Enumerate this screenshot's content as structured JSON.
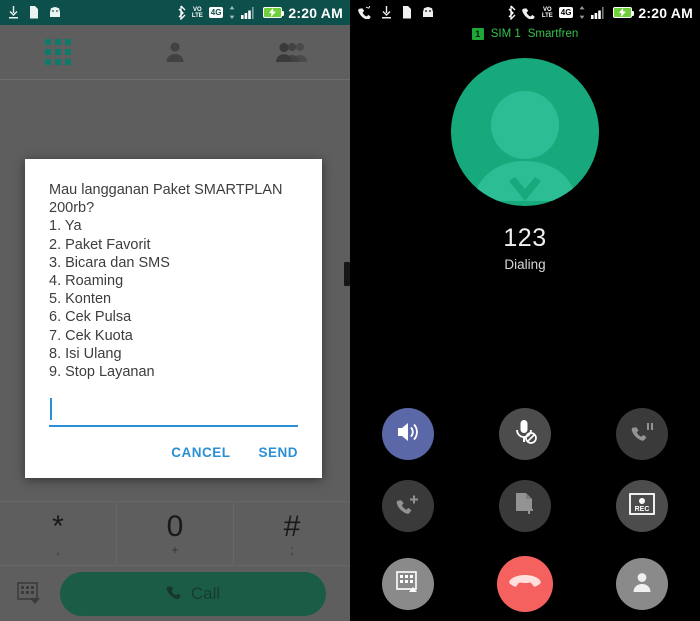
{
  "left_panel": {
    "statusbar": {
      "time": "2:20 AM",
      "icons": [
        "download-icon",
        "sd-card-icon",
        "android-icon",
        "bluetooth-icon",
        "volte-icon",
        "4g-icon",
        "signal-bars-icon",
        "battery-charging-icon"
      ],
      "volte_label": "VO",
      "volte_sub": "LTE",
      "network_label": "4G"
    },
    "tabs": [
      {
        "name": "dialpad",
        "icon": "dialpad-grid-icon",
        "active": true
      },
      {
        "name": "contacts",
        "icon": "person-icon",
        "active": false
      },
      {
        "name": "groups",
        "icon": "people-group-icon",
        "active": false
      }
    ],
    "keypad": [
      {
        "main": "*",
        "sub": ","
      },
      {
        "main": "0",
        "sub": "+"
      },
      {
        "main": "#",
        "sub": ";"
      }
    ],
    "call_bar": {
      "hide_dialpad_icon": "dialpad-collapse-icon",
      "call_label": "Call",
      "call_icon": "phone-icon",
      "call_color": "#1b5c47"
    },
    "dialog": {
      "message": "Mau langganan Paket SMARTPLAN 200rb?\n1. Ya\n2. Paket Favorit\n3. Bicara dan SMS\n4. Roaming\n5. Konten\n6. Cek Pulsa\n7. Cek Kuota\n8. Isi Ulang\n9. Stop Layanan",
      "input_value": "",
      "input_placeholder": "",
      "cancel_label": "CANCEL",
      "send_label": "SEND",
      "action_color": "#2a90d3"
    }
  },
  "right_panel": {
    "statusbar": {
      "time": "2:20 AM",
      "icons": [
        "missed-call-icon",
        "download-icon",
        "sd-card-icon",
        "android-icon",
        "bluetooth-icon",
        "call-icon",
        "volte-icon",
        "4g-icon",
        "signal-bars-icon",
        "battery-charging-icon"
      ],
      "volte_label": "VO",
      "volte_sub": "LTE",
      "network_label": "4G"
    },
    "sim_line": {
      "badge": "1",
      "sim_label": "SIM 1",
      "carrier": "Smartfren",
      "color": "#37c14e"
    },
    "call": {
      "avatar_icon": "person-avatar-icon",
      "avatar_color": "#17a87c",
      "number": "123",
      "state": "Dialing"
    },
    "controls": [
      {
        "name": "speaker-button",
        "icon": "speaker-icon",
        "state": "active"
      },
      {
        "name": "mute-button",
        "icon": "mic-muted-icon",
        "state": "enabled"
      },
      {
        "name": "hold-button",
        "icon": "call-hold-icon",
        "state": "disabled"
      },
      {
        "name": "add-call-button",
        "icon": "add-call-icon",
        "state": "disabled"
      },
      {
        "name": "transfer-button",
        "icon": "note-add-icon",
        "state": "disabled"
      },
      {
        "name": "record-button",
        "icon": "rec-icon",
        "state": "enabled"
      }
    ],
    "bottom_controls": [
      {
        "name": "show-dialpad-button",
        "icon": "dialpad-expand-icon"
      },
      {
        "name": "end-call-button",
        "icon": "end-call-icon",
        "color": "#f4615f"
      },
      {
        "name": "contacts-button",
        "icon": "person-icon"
      }
    ]
  }
}
